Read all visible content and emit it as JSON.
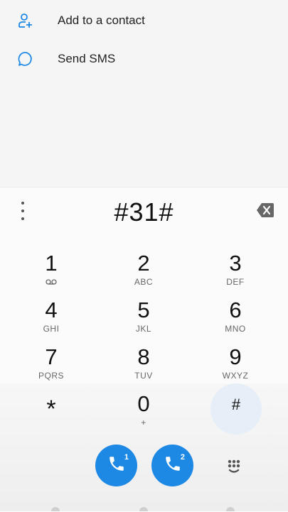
{
  "options": [
    {
      "label": "Add to a contact",
      "icon": "add-contact-icon"
    },
    {
      "label": "Send SMS",
      "icon": "message-icon"
    }
  ],
  "dialer": {
    "number": "#31#",
    "keys": [
      {
        "digit": "1",
        "letters": ""
      },
      {
        "digit": "2",
        "letters": "ABC"
      },
      {
        "digit": "3",
        "letters": "DEF"
      },
      {
        "digit": "4",
        "letters": "GHI"
      },
      {
        "digit": "5",
        "letters": "JKL"
      },
      {
        "digit": "6",
        "letters": "MNO"
      },
      {
        "digit": "7",
        "letters": "PQRS"
      },
      {
        "digit": "8",
        "letters": "TUV"
      },
      {
        "digit": "9",
        "letters": "WXYZ"
      },
      {
        "digit": "*",
        "letters": ""
      },
      {
        "digit": "0",
        "letters": "+"
      },
      {
        "digit": "#",
        "letters": ""
      }
    ],
    "sim1": "1",
    "sim2": "2"
  },
  "colors": {
    "accent": "#1e88e5",
    "icon_blue": "#1e88e5"
  }
}
